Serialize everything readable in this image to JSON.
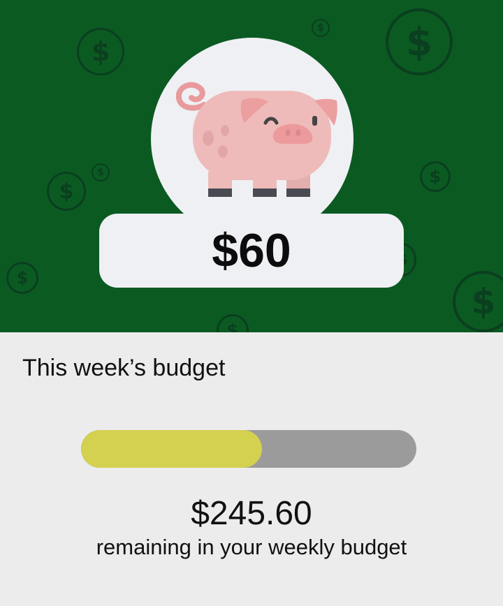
{
  "hero": {
    "piggy_balance": "$60",
    "background_color": "#0b5a22",
    "icon": "piggy-bank-icon",
    "decoration_icon": "dollar-coin-icon"
  },
  "budget": {
    "section_title": "This week’s budget",
    "progress_fraction": 0.54,
    "progress_fill_color": "#d4d050",
    "progress_track_color": "#9b9b9b",
    "remaining_amount": "$245.60",
    "remaining_caption": "remaining in your weekly budget"
  }
}
